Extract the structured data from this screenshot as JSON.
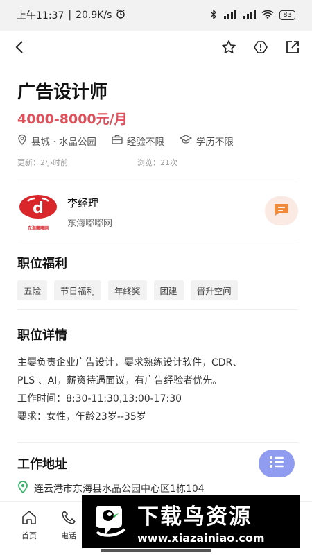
{
  "status_bar": {
    "time": "上午11:37",
    "speed": "20.9K/s",
    "battery": "83",
    "signal_labels": [
      "HD",
      "HD"
    ]
  },
  "job": {
    "title": "广告设计师",
    "salary": "4000-8000元/月",
    "location": "县城 · 水晶公园",
    "experience": "经验不限",
    "education": "学历不限",
    "updated": "更新：2小时前",
    "views": "浏览：21次"
  },
  "recruiter": {
    "name": "李经理",
    "company": "东海嘟嘟网",
    "logo_text": "东海嘟嘟网"
  },
  "benefits": {
    "title": "职位福利",
    "tags": [
      "五险",
      "节日福利",
      "年终奖",
      "团建",
      "晋升空间"
    ]
  },
  "details": {
    "title": "职位详情",
    "line1": "主要负责企业广告设计，要求熟练设计软件，CDR、",
    "line2": "PLS 、AI，薪资待遇面议，有广告经验者优先。",
    "line3": "工作时间：8:30-11:30,13:00-17:30",
    "line4": "要求：女性，年龄23岁--35岁"
  },
  "address": {
    "title": "工作地址",
    "text": "连云港市东海县水晶公园中心区1栋104"
  },
  "tabbar": {
    "home": "首页",
    "phone": "电话"
  },
  "watermark": {
    "title": "下载鸟资源",
    "url": "www.xiazainiao.com"
  },
  "colors": {
    "salary": "#e0505a",
    "accent": "#8f9cf0",
    "chat_bg": "#fbe9e4",
    "chat_icon": "#f08a3c",
    "location_green": "#3bb36a"
  },
  "icons": {
    "back": "back-arrow-icon",
    "favorite": "star-icon",
    "report": "alert-icon",
    "share": "share-icon",
    "location": "location-pin-icon",
    "experience": "briefcase-icon",
    "education": "graduation-cap-icon",
    "chat": "message-icon",
    "list": "list-icon",
    "home": "home-icon",
    "phone": "phone-icon"
  }
}
